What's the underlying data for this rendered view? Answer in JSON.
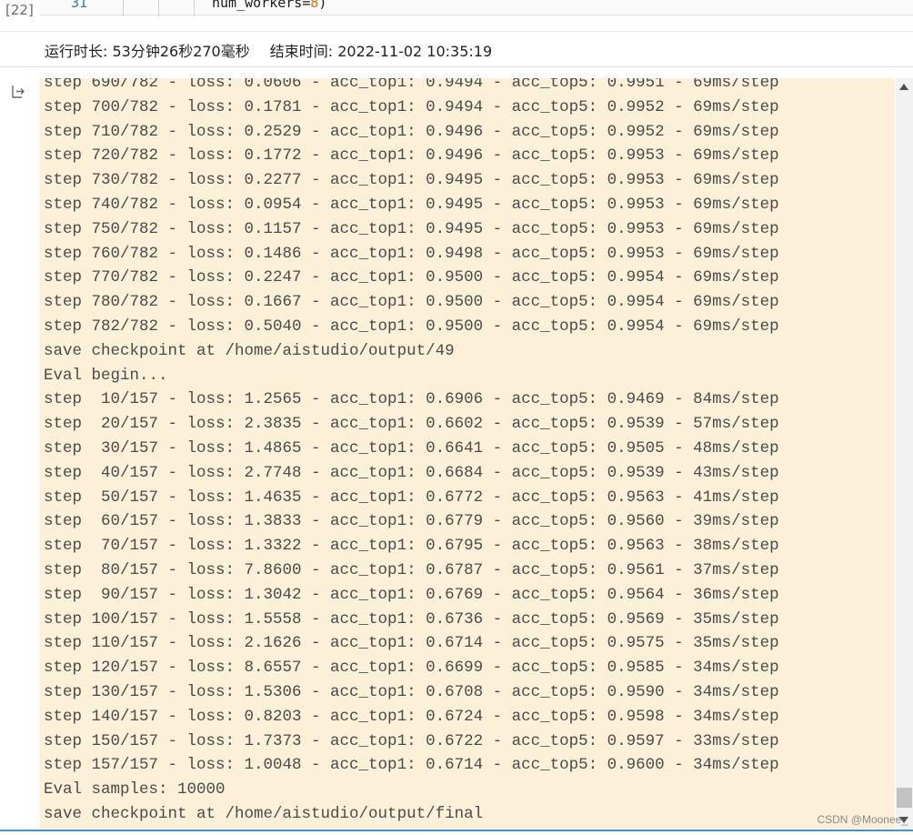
{
  "cell": {
    "execution_count": "[22]",
    "line_number": "31",
    "code_line": "num_workers=",
    "code_number": "8",
    "code_end": ")"
  },
  "runtime": {
    "duration": "运行时长: 53分钟26秒270毫秒",
    "end_time": "结束时间: 2022-11-02 10:35:19"
  },
  "output": {
    "lines": [
      "step 690/782 - loss: 0.0606 - acc_top1: 0.9494 - acc_top5: 0.9951 - 69ms/step",
      "step 700/782 - loss: 0.1781 - acc_top1: 0.9494 - acc_top5: 0.9952 - 69ms/step",
      "step 710/782 - loss: 0.2529 - acc_top1: 0.9496 - acc_top5: 0.9952 - 69ms/step",
      "step 720/782 - loss: 0.1772 - acc_top1: 0.9496 - acc_top5: 0.9953 - 69ms/step",
      "step 730/782 - loss: 0.2277 - acc_top1: 0.9495 - acc_top5: 0.9953 - 69ms/step",
      "step 740/782 - loss: 0.0954 - acc_top1: 0.9495 - acc_top5: 0.9953 - 69ms/step",
      "step 750/782 - loss: 0.1157 - acc_top1: 0.9495 - acc_top5: 0.9953 - 69ms/step",
      "step 760/782 - loss: 0.1486 - acc_top1: 0.9498 - acc_top5: 0.9953 - 69ms/step",
      "step 770/782 - loss: 0.2247 - acc_top1: 0.9500 - acc_top5: 0.9954 - 69ms/step",
      "step 780/782 - loss: 0.1667 - acc_top1: 0.9500 - acc_top5: 0.9954 - 69ms/step",
      "step 782/782 - loss: 0.5040 - acc_top1: 0.9500 - acc_top5: 0.9954 - 69ms/step",
      "save checkpoint at /home/aistudio/output/49",
      "Eval begin...",
      "step  10/157 - loss: 1.2565 - acc_top1: 0.6906 - acc_top5: 0.9469 - 84ms/step",
      "step  20/157 - loss: 2.3835 - acc_top1: 0.6602 - acc_top5: 0.9539 - 57ms/step",
      "step  30/157 - loss: 1.4865 - acc_top1: 0.6641 - acc_top5: 0.9505 - 48ms/step",
      "step  40/157 - loss: 2.7748 - acc_top1: 0.6684 - acc_top5: 0.9539 - 43ms/step",
      "step  50/157 - loss: 1.4635 - acc_top1: 0.6772 - acc_top5: 0.9563 - 41ms/step",
      "step  60/157 - loss: 1.3833 - acc_top1: 0.6779 - acc_top5: 0.9560 - 39ms/step",
      "step  70/157 - loss: 1.3322 - acc_top1: 0.6795 - acc_top5: 0.9563 - 38ms/step",
      "step  80/157 - loss: 7.8600 - acc_top1: 0.6787 - acc_top5: 0.9561 - 37ms/step",
      "step  90/157 - loss: 1.3042 - acc_top1: 0.6769 - acc_top5: 0.9564 - 36ms/step",
      "step 100/157 - loss: 1.5558 - acc_top1: 0.6736 - acc_top5: 0.9569 - 35ms/step",
      "step 110/157 - loss: 2.1626 - acc_top1: 0.6714 - acc_top5: 0.9575 - 35ms/step",
      "step 120/157 - loss: 8.6557 - acc_top1: 0.6699 - acc_top5: 0.9585 - 34ms/step",
      "step 130/157 - loss: 1.5306 - acc_top1: 0.6708 - acc_top5: 0.9590 - 34ms/step",
      "step 140/157 - loss: 0.8203 - acc_top1: 0.6724 - acc_top5: 0.9598 - 34ms/step",
      "step 150/157 - loss: 1.7373 - acc_top1: 0.6722 - acc_top5: 0.9597 - 33ms/step",
      "step 157/157 - loss: 1.0048 - acc_top1: 0.6714 - acc_top5: 0.9600 - 34ms/step",
      "Eval samples: 10000",
      "save checkpoint at /home/aistudio/output/final"
    ]
  },
  "watermark": "CSDN @Moonee_",
  "icons": {
    "output": "output-arrow-icon",
    "scroll_up": "scroll-up-arrow-icon",
    "scroll_down": "scroll-down-arrow-icon"
  },
  "colors": {
    "output_background": "#fdf0d8",
    "line_number": "#2a7ab0",
    "code_number": "#d96e0a",
    "bottom_rule": "#4a90d9"
  }
}
